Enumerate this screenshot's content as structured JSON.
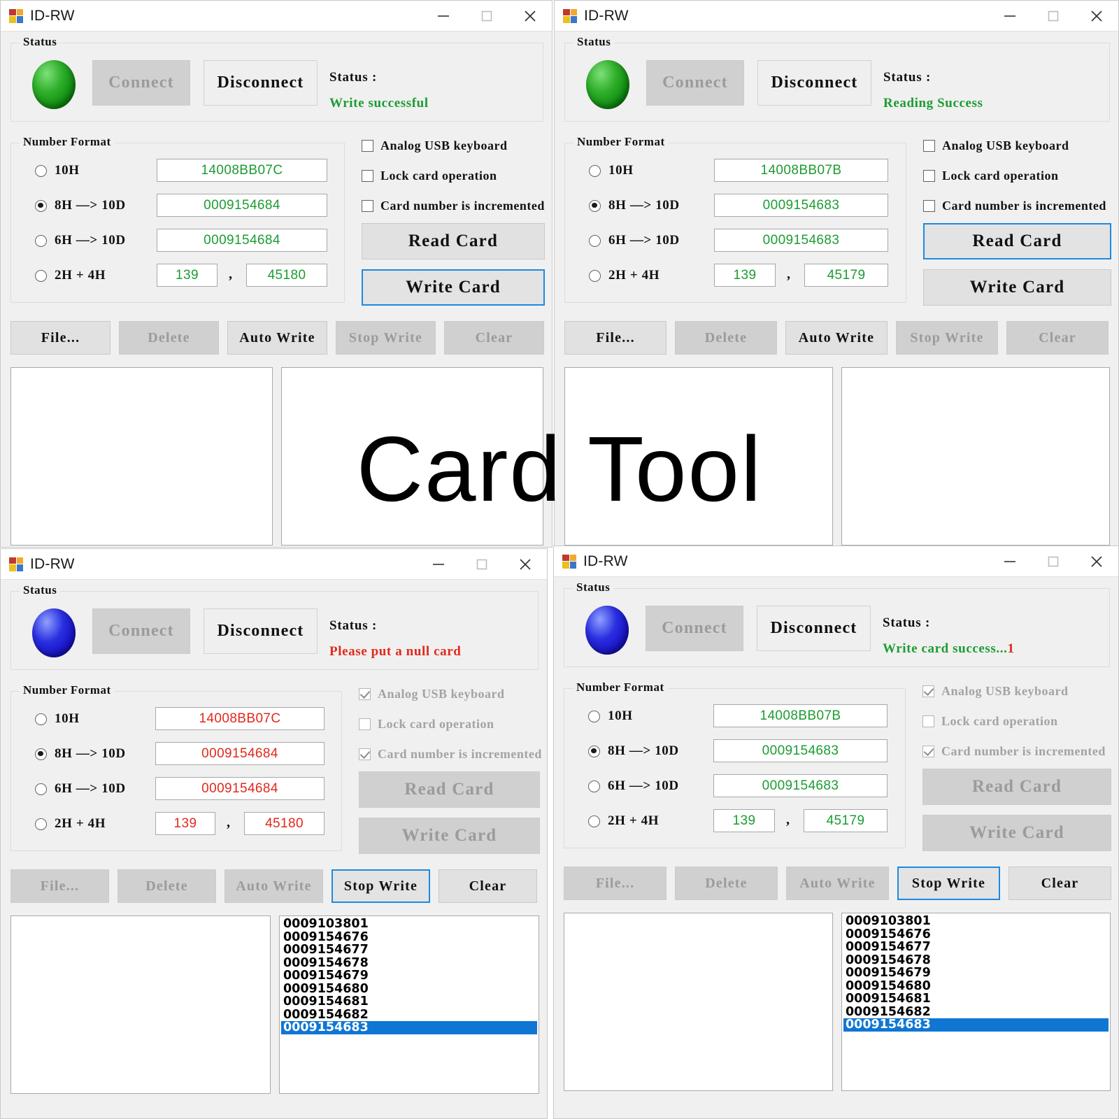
{
  "overlay": {
    "watermark": "Card Tool"
  },
  "window": {
    "title": "ID-RW",
    "icon": "app-grid-icon",
    "controls": {
      "minimize": "minimize-icon",
      "maximize": "maximize-icon",
      "close": "close-icon"
    }
  },
  "labels": {
    "status_group": "Status",
    "number_format_group": "Number Format",
    "status_prefix": "Status :",
    "connect": "Connect",
    "disconnect": "Disconnect",
    "read_card": "Read Card",
    "write_card": "Write Card",
    "file": "File...",
    "delete": "Delete",
    "auto_write": "Auto Write",
    "stop_write": "Stop Write",
    "clear": "Clear",
    "radio_10h": "10H",
    "radio_8h": "8H —> 10D",
    "radio_6h": "6H —> 10D",
    "radio_2h4h": "2H + 4H",
    "cb_analog": "Analog USB keyboard",
    "cb_lock": "Lock card operation",
    "cb_increment": "Card number is incremented",
    "comma": ","
  },
  "colors": {
    "green_text": "#1c9c32",
    "red_text": "#e2281c",
    "focus_blue": "#1e8ae0",
    "selection_blue": "#1076d4",
    "led_green": "#2fae2a",
    "led_blue": "#2a2fe0"
  },
  "panels": [
    {
      "id": "panel-top-left",
      "led": "green",
      "status_text": "Write successful",
      "status_color": "#1c9c32",
      "fields": {
        "hex10": "14008BB07C",
        "dec8": "0009154684",
        "dec6": "0009154684",
        "part_a": "139",
        "part_b": "45180"
      },
      "field_color": "green",
      "selected_radio": "8h",
      "checkboxes": {
        "analog": false,
        "lock": false,
        "increment": false
      },
      "checkbox_enabled": true,
      "buttons": {
        "connect_enabled": false,
        "disconnect_enabled": true,
        "read_enabled": true,
        "read_focused": false,
        "write_enabled": true,
        "write_focused": true,
        "file_enabled": true,
        "delete_enabled": false,
        "auto_write_enabled": true,
        "stop_write_enabled": false,
        "clear_enabled": false,
        "stop_write_focused": false
      },
      "list_items": [],
      "selected_index": -1
    },
    {
      "id": "panel-top-right",
      "led": "green",
      "status_text": "Reading Success",
      "status_color": "#1c9c32",
      "fields": {
        "hex10": "14008BB07B",
        "dec8": "0009154683",
        "dec6": "0009154683",
        "part_a": "139",
        "part_b": "45179"
      },
      "field_color": "green",
      "selected_radio": "8h",
      "checkboxes": {
        "analog": false,
        "lock": false,
        "increment": false
      },
      "checkbox_enabled": true,
      "buttons": {
        "connect_enabled": false,
        "disconnect_enabled": true,
        "read_enabled": true,
        "read_focused": true,
        "write_enabled": true,
        "write_focused": false,
        "file_enabled": true,
        "delete_enabled": false,
        "auto_write_enabled": true,
        "stop_write_enabled": false,
        "clear_enabled": false,
        "stop_write_focused": false
      },
      "list_items": [],
      "selected_index": -1
    },
    {
      "id": "panel-bottom-left",
      "led": "blue",
      "status_text": "Please put a null card",
      "status_color": "#e2281c",
      "fields": {
        "hex10": "14008BB07C",
        "dec8": "0009154684",
        "dec6": "0009154684",
        "part_a": "139",
        "part_b": "45180"
      },
      "field_color": "red",
      "selected_radio": "8h",
      "checkboxes": {
        "analog": true,
        "lock": false,
        "increment": true
      },
      "checkbox_enabled": false,
      "buttons": {
        "connect_enabled": false,
        "disconnect_enabled": true,
        "read_enabled": false,
        "read_focused": false,
        "write_enabled": false,
        "write_focused": false,
        "file_enabled": false,
        "delete_enabled": false,
        "auto_write_enabled": false,
        "stop_write_enabled": true,
        "clear_enabled": true,
        "stop_write_focused": true
      },
      "list_items": [
        "0009103801",
        "0009154676",
        "0009154677",
        "0009154678",
        "0009154679",
        "0009154680",
        "0009154681",
        "0009154682",
        "0009154683"
      ],
      "selected_index": 8
    },
    {
      "id": "panel-bottom-right",
      "led": "blue",
      "status_text": "Write card success...1",
      "status_color": "#1c9c32",
      "status_tail": "1",
      "status_tail_color": "#e2281c",
      "fields": {
        "hex10": "14008BB07B",
        "dec8": "0009154683",
        "dec6": "0009154683",
        "part_a": "139",
        "part_b": "45179"
      },
      "field_color": "green",
      "selected_radio": "8h",
      "checkboxes": {
        "analog": true,
        "lock": false,
        "increment": true
      },
      "checkbox_enabled": false,
      "buttons": {
        "connect_enabled": false,
        "disconnect_enabled": true,
        "read_enabled": false,
        "read_focused": false,
        "write_enabled": false,
        "write_focused": false,
        "file_enabled": false,
        "delete_enabled": false,
        "auto_write_enabled": false,
        "stop_write_enabled": true,
        "clear_enabled": true,
        "stop_write_focused": true
      },
      "list_items": [
        "0009103801",
        "0009154676",
        "0009154677",
        "0009154678",
        "0009154679",
        "0009154680",
        "0009154681",
        "0009154682",
        "0009154683"
      ],
      "selected_index": 8
    }
  ]
}
